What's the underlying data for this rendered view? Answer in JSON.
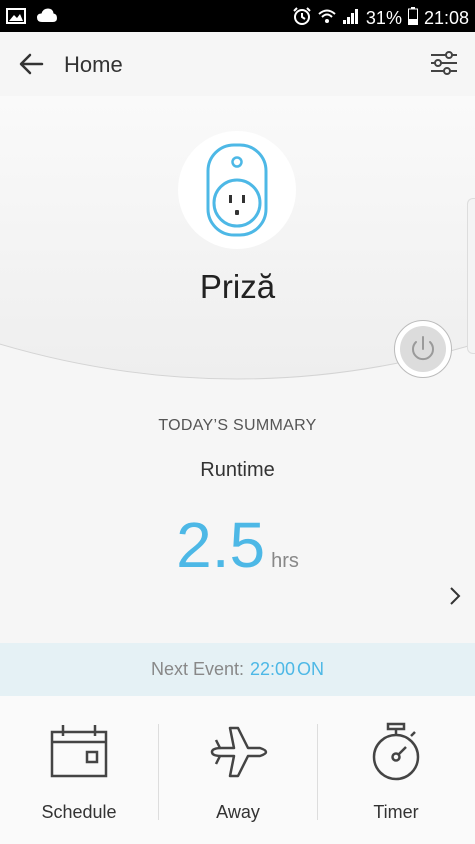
{
  "status_bar": {
    "battery": "31%",
    "time": "21:08",
    "icons": [
      "image-icon",
      "cloud-icon",
      "alarm-icon",
      "wifi-icon",
      "signal-icon",
      "battery-icon"
    ]
  },
  "header": {
    "title": "Home",
    "back_icon": "arrow-left-icon",
    "settings_icon": "sliders-icon"
  },
  "device": {
    "name": "Priză",
    "icon": "smart-plug-icon",
    "power_icon": "power-icon"
  },
  "summary": {
    "title": "TODAY’S SUMMARY",
    "label": "Runtime",
    "value": "2.5",
    "unit": "hrs"
  },
  "next_event": {
    "label": "Next Event:",
    "time": "22:00",
    "state": "ON"
  },
  "tabs": [
    {
      "label": "Schedule",
      "icon": "calendar-icon"
    },
    {
      "label": "Away",
      "icon": "airplane-icon"
    },
    {
      "label": "Timer",
      "icon": "stopwatch-icon"
    }
  ],
  "colors": {
    "accent": "#4db8e6",
    "event_bar": "#e5f1f5"
  }
}
